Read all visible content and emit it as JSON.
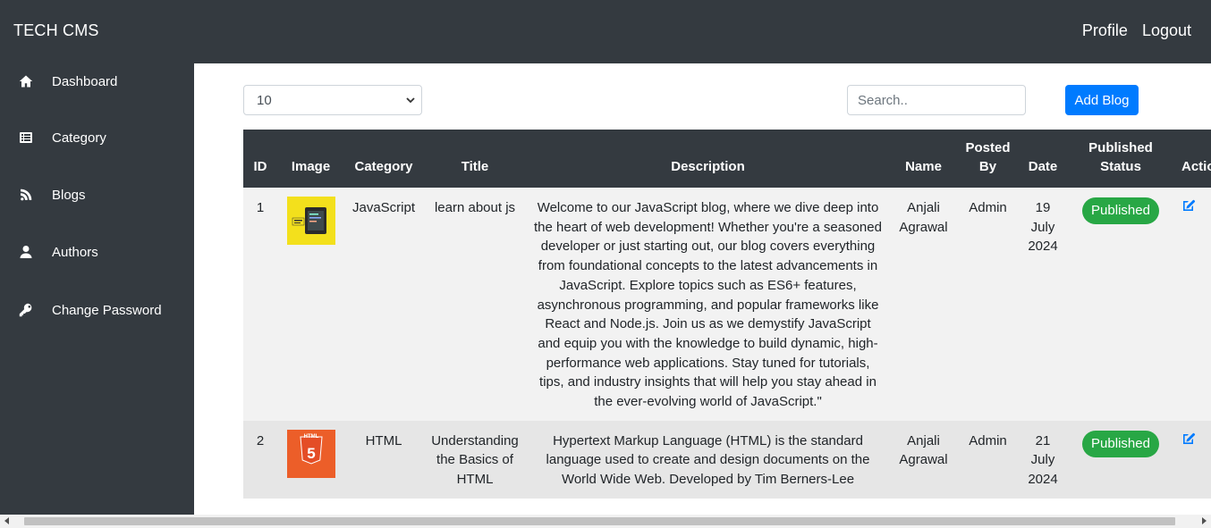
{
  "header": {
    "brand": "TECH CMS",
    "profile_label": "Profile",
    "logout_label": "Logout"
  },
  "sidebar": {
    "items": [
      {
        "label": "Dashboard",
        "icon": "home-icon"
      },
      {
        "label": "Category",
        "icon": "list-icon"
      },
      {
        "label": "Blogs",
        "icon": "blog-icon"
      },
      {
        "label": "Authors",
        "icon": "user-icon"
      },
      {
        "label": "Change Password",
        "icon": "key-icon"
      }
    ]
  },
  "toolbar": {
    "page_size_value": "10",
    "search_placeholder": "Search..",
    "add_label": "Add Blog"
  },
  "table": {
    "columns": [
      "ID",
      "Image",
      "Category",
      "Title",
      "Description",
      "Name",
      "Posted By",
      "Date",
      "Published Status",
      "Actio"
    ],
    "rows": [
      {
        "id": "1",
        "image": "javascript-thumbnail",
        "category": "JavaScript",
        "title": "learn about js",
        "description": "Welcome to our JavaScript blog, where we dive deep into the heart of web development! Whether you're a seasoned developer or just starting out, our blog covers everything from foundational concepts to the latest advancements in JavaScript. Explore topics such as ES6+ features, asynchronous programming, and popular frameworks like React and Node.js. Join us as we demystify JavaScript and equip you with the knowledge to build dynamic, high-performance web applications. Stay tuned for tutorials, tips, and industry insights that will help you stay ahead in the ever-evolving world of JavaScript.\"",
        "name": "Anjali Agrawal",
        "posted_by": "Admin",
        "date": "19 July 2024",
        "status": "Published"
      },
      {
        "id": "2",
        "image": "html5-thumbnail",
        "category": "HTML",
        "title": "Understanding the Basics of HTML",
        "description": "Hypertext Markup Language (HTML) is the standard language used to create and design documents on the World Wide Web. Developed by Tim Berners-Lee",
        "name": "Anjali Agrawal",
        "posted_by": "Admin",
        "date": "21 July 2024",
        "status": "Published"
      }
    ]
  },
  "colors": {
    "dark": "#343a40",
    "primary": "#007bff",
    "success": "#28a745"
  }
}
